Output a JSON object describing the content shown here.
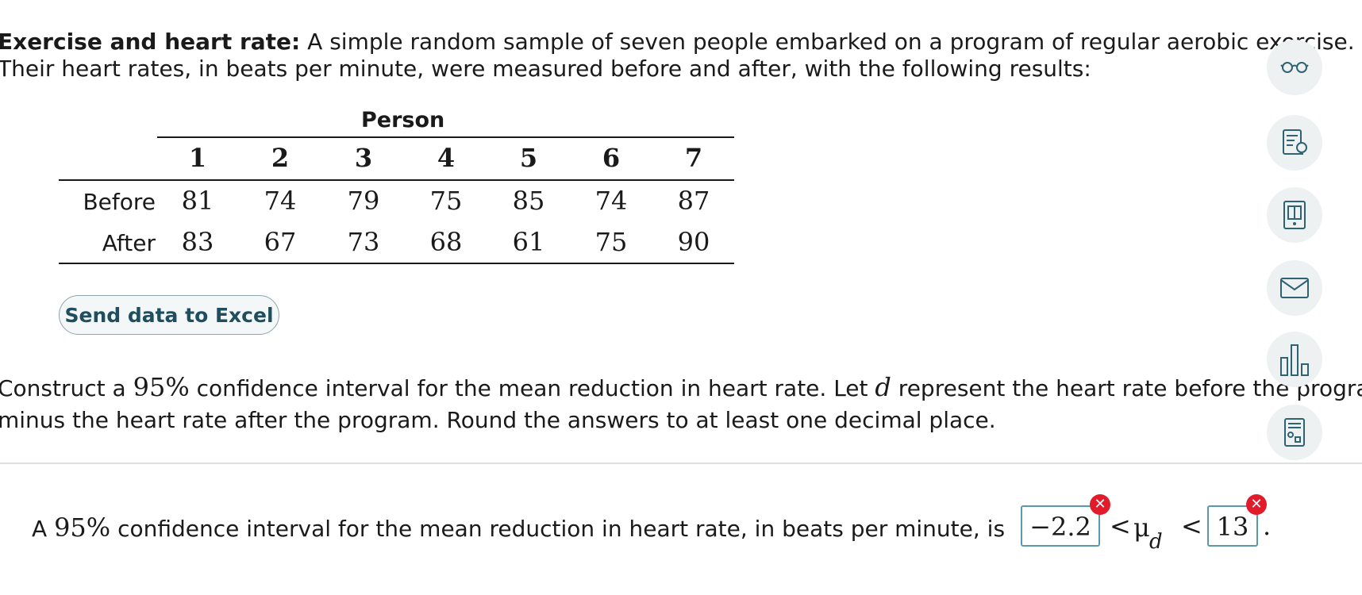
{
  "problem": {
    "title": "Exercise and heart rate:",
    "line1_rest": " A simple random sample of seven people embarked on a program of regular aerobic exercise.",
    "line2": "Their heart rates, in beats per minute, were measured before and after, with the following results:"
  },
  "table": {
    "group_label": "Person",
    "columns": [
      "1",
      "2",
      "3",
      "4",
      "5",
      "6",
      "7"
    ],
    "rows": [
      {
        "label": "Before",
        "values": [
          "81",
          "74",
          "79",
          "75",
          "85",
          "74",
          "87"
        ]
      },
      {
        "label": "After",
        "values": [
          "83",
          "67",
          "73",
          "68",
          "61",
          "75",
          "90"
        ]
      }
    ]
  },
  "excel_button": "Send data to Excel",
  "construct": {
    "part1": "Construct a ",
    "percent": "95%",
    "part2": " confidence interval for the mean reduction in heart rate. Let ",
    "var": "d",
    "part3": " represent the heart rate before the progra",
    "line2": "minus the heart rate after the program. Round the answers to at least one decimal place."
  },
  "answer": {
    "prefix": "A ",
    "percent": "95%",
    "text": " confidence interval for the mean reduction in heart rate, in beats per minute, is",
    "lower_value": "−2.2",
    "upper_value": "13",
    "lt": "<",
    "mu": "μ",
    "sub": "d",
    "period": ".",
    "error_symbol": "✕"
  },
  "colors": {
    "error": "#e21b2b",
    "input_border": "#5a9aa8",
    "tool_bg": "#eef1f2",
    "tool_icon": "#2f6272"
  },
  "tools": [
    "glasses-icon",
    "explanation-icon",
    "ebook-icon",
    "mail-icon",
    "chart-icon",
    "calculator-icon"
  ]
}
